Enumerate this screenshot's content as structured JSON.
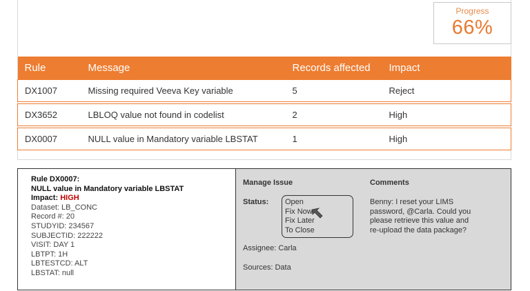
{
  "progress": {
    "label": "Progress",
    "value": "66%"
  },
  "table": {
    "headers": [
      "Rule",
      "Message",
      "Records affected",
      "Impact"
    ],
    "rows": [
      {
        "rule": "DX1007",
        "message": "Missing required Veeva Key variable",
        "records": "5",
        "impact": "Reject"
      },
      {
        "rule": "DX3652",
        "message": "LBLOQ value not found in codelist",
        "records": "2",
        "impact": "High"
      },
      {
        "rule": "DX0007",
        "message": "NULL value in Mandatory variable LBSTAT",
        "records": "1",
        "impact": "High"
      }
    ]
  },
  "detail": {
    "rule_title": "Rule DX0007:",
    "rule_message": "NULL value in Mandatory variable LBSTAT",
    "impact_label": "Impact:",
    "impact_value": "HIGH",
    "fields": [
      "Dataset: LB_CONC",
      "Record #: 20",
      "STUDYID: 234567",
      "SUBJECTID: 222222",
      "VISIT: DAY 1",
      "LBTPT: 1H",
      "LBTESTCD: ALT",
      "LBSTAT: null"
    ]
  },
  "manage": {
    "title": "Manage Issue",
    "status_label": "Status:",
    "status_options": [
      "Open",
      "Fix Now",
      "Fix Later",
      "To Close"
    ],
    "assignee": "Assignee: Carla",
    "sources": "Sources: Data"
  },
  "comments": {
    "title": "Comments",
    "text": "Benny: I reset your LIMS password, @Carla. Could you please retrieve this value and re-upload the data package?"
  },
  "colors": {
    "accent": "#ed7d31",
    "impact_high": "#c00000",
    "manage_bg": "#d9d9d9"
  },
  "icons": {
    "pointer": "cursor-arrow-icon"
  }
}
